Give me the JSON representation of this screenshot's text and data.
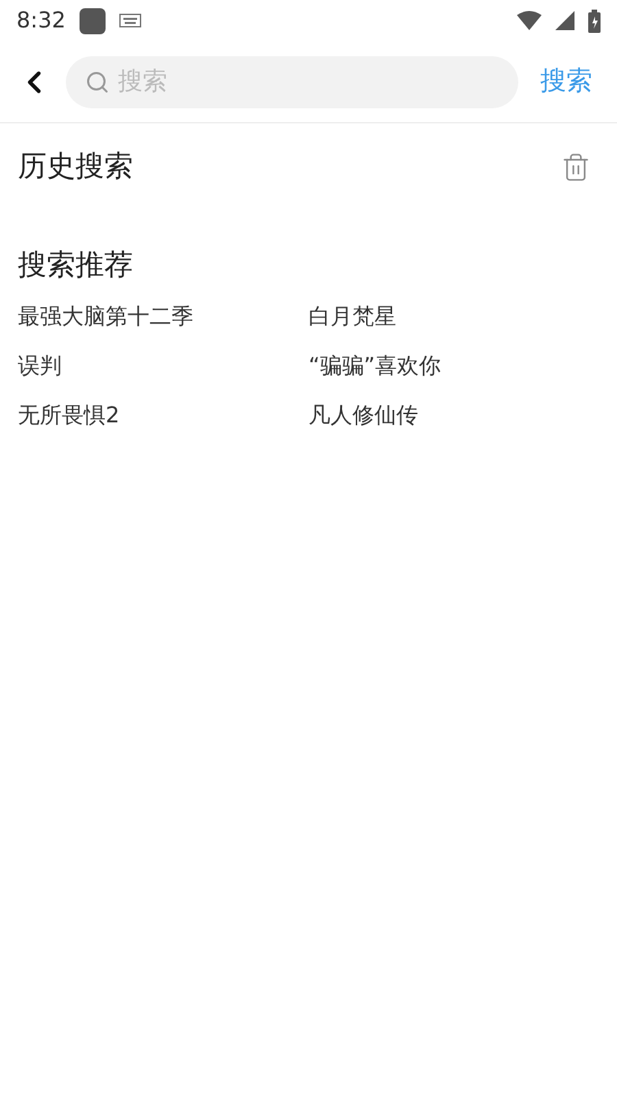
{
  "status_bar": {
    "time": "8:32"
  },
  "search_bar": {
    "placeholder": "搜索",
    "button": "搜索"
  },
  "history": {
    "title": "历史搜索"
  },
  "recommend": {
    "title": "搜索推荐",
    "items": [
      "最强大脑第十二季",
      "白月梵星",
      "误判",
      "“骗骗”喜欢你",
      "无所畏惧2",
      "凡人修仙传"
    ]
  }
}
